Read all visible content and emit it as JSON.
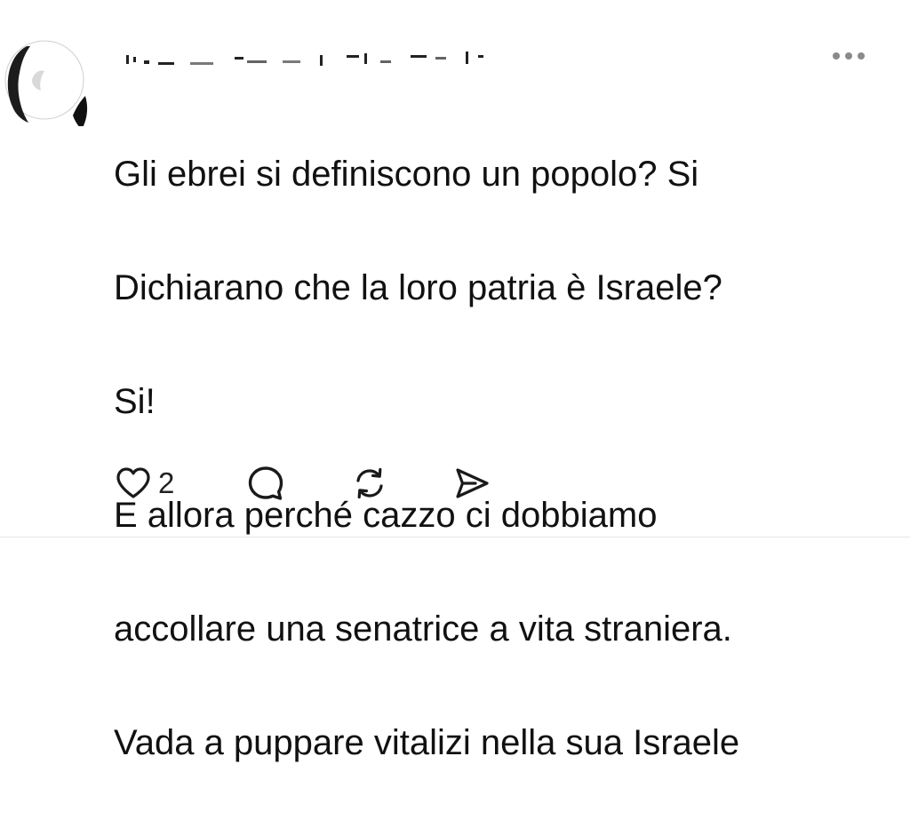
{
  "post": {
    "author_name": "",
    "text_lines": [
      "Gli ebrei si definiscono un popolo? Si",
      "Dichiarano che la loro patria è Israele?",
      "Si!",
      "E allora perché cazzo ci dobbiamo",
      "accollare una senatrice a vita straniera.",
      "Vada a puppare vitalizi nella sua Israele"
    ]
  },
  "actions": {
    "like_icon": "heart-icon",
    "like_count": "2",
    "reply_icon": "speech-bubble-icon",
    "repost_icon": "repost-icon",
    "share_icon": "send-icon"
  },
  "menu": {
    "icon": "more-horizontal-icon"
  },
  "colors": {
    "text": "#111111",
    "icon": "#1a1a1a",
    "muted": "#8a8a8a",
    "background": "#ffffff"
  }
}
